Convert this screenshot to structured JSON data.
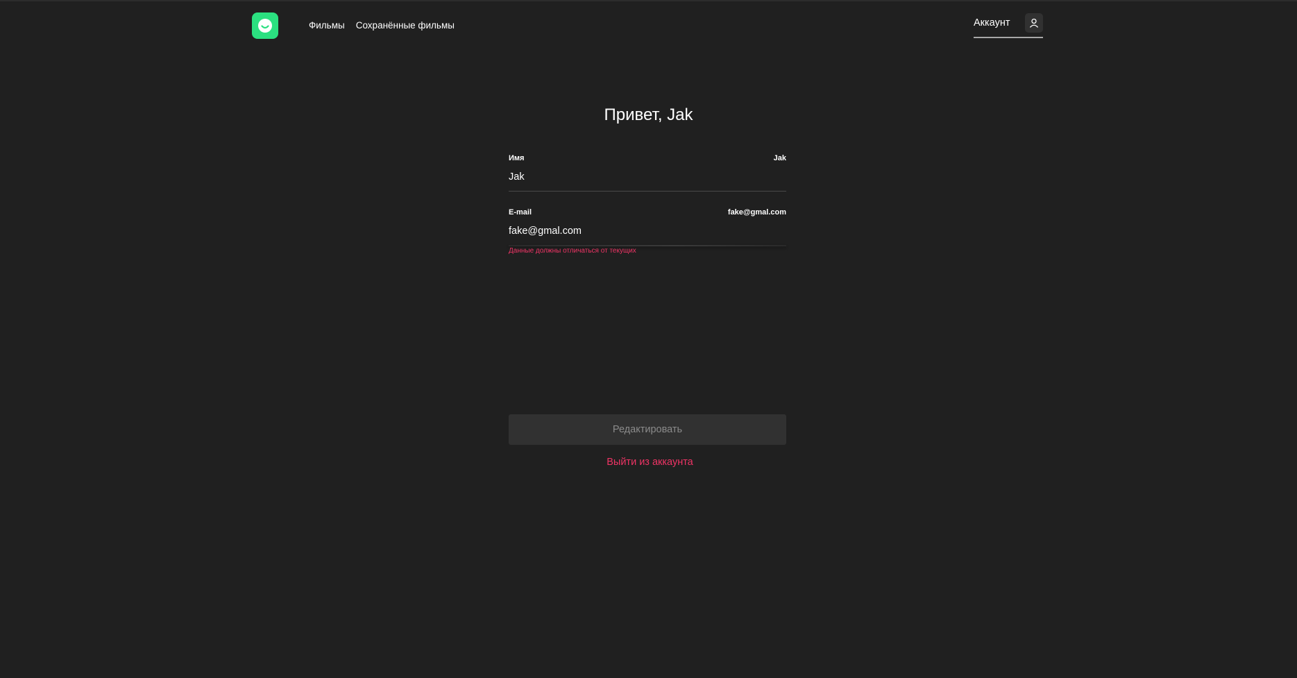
{
  "header": {
    "logo_icon": "smile-logo-icon",
    "nav": {
      "films": "Фильмы",
      "saved_films": "Сохранённые фильмы"
    },
    "account": {
      "label": "Аккаунт",
      "icon": "user-icon"
    }
  },
  "profile": {
    "greeting": "Привет, Jak",
    "name_field": {
      "label": "Имя",
      "current_value": "Jak",
      "input_value": "Jak"
    },
    "email_field": {
      "label": "E-mail",
      "current_value": "fake@gmal.com",
      "input_value": "fake@gmal.com",
      "error": "Данные должны отличаться от текущих"
    },
    "edit_button": "Редактировать",
    "logout_link": "Выйти из аккаунта"
  },
  "colors": {
    "background": "#202020",
    "logo": "#2be080",
    "error": "#ee3465",
    "button_bg": "#313131",
    "button_text": "#8b8b8b"
  }
}
